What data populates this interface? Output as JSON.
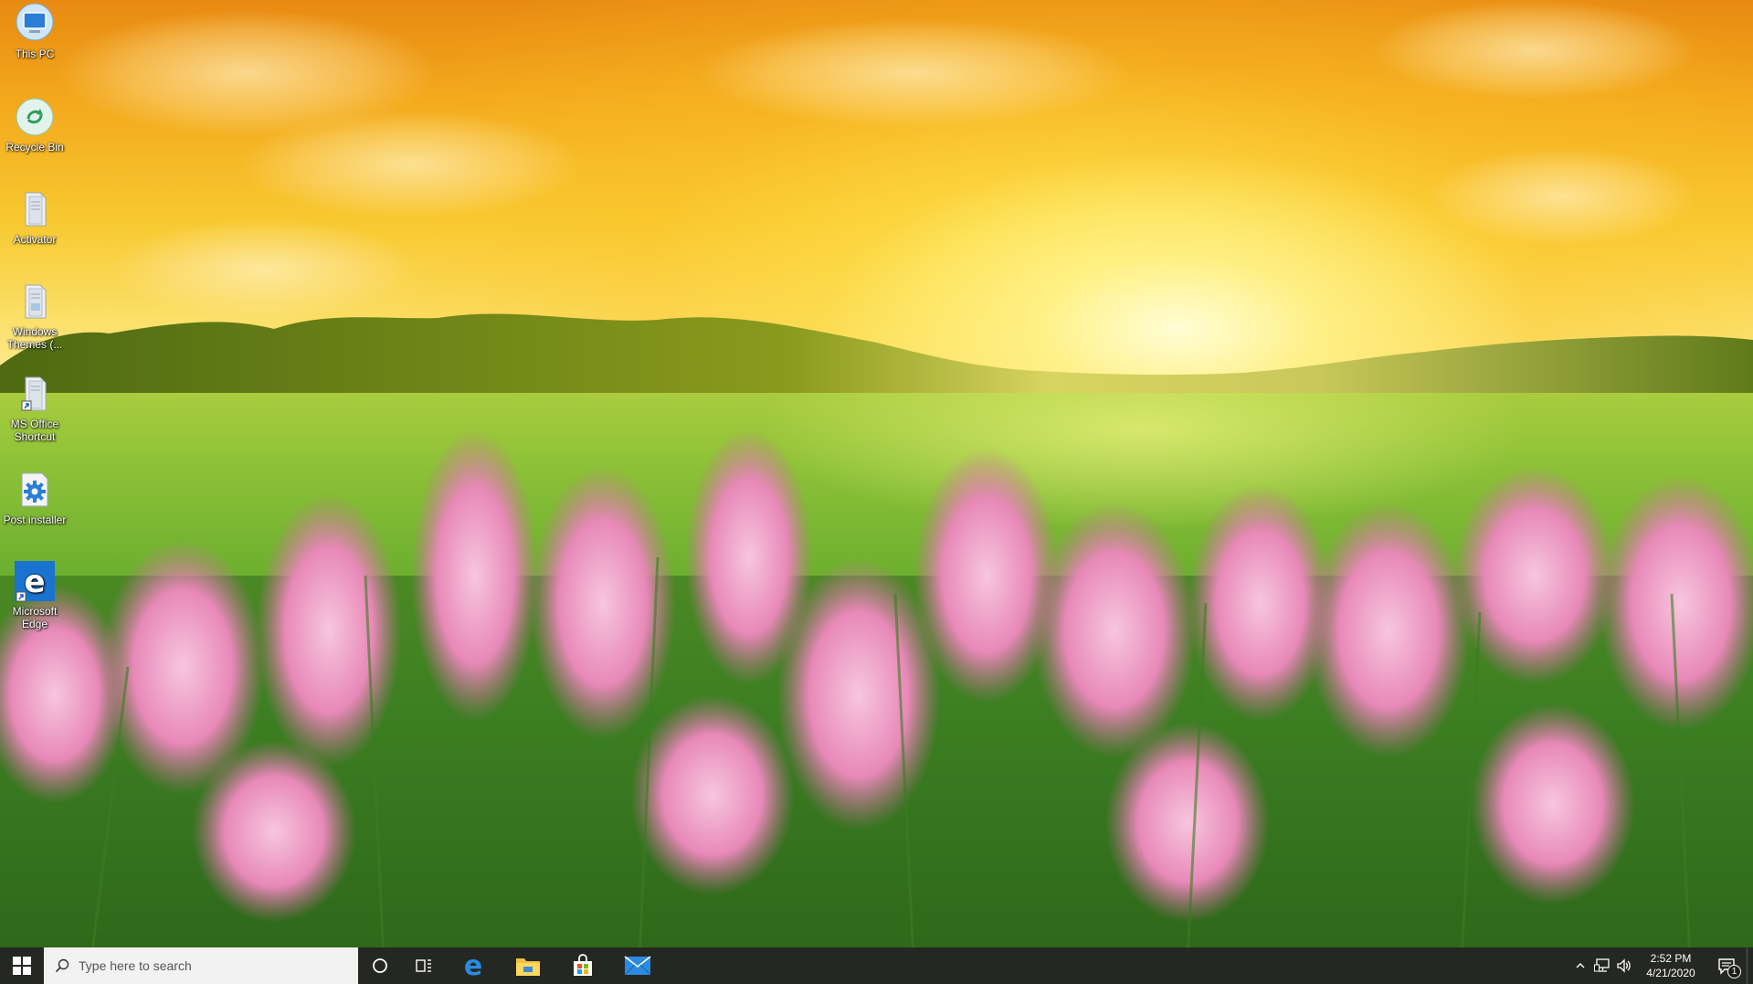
{
  "desktop": {
    "icons": [
      {
        "label": "This PC",
        "icon": "computer-icon"
      },
      {
        "label": "Recycle Bin",
        "icon": "recycle-bin-icon"
      },
      {
        "label": "Activator",
        "icon": "document-icon"
      },
      {
        "label": "Windows Themes (...",
        "icon": "document-icon"
      },
      {
        "label": "MS Office Shortcut",
        "icon": "shortcut-document-icon"
      },
      {
        "label": "Post installer",
        "icon": "gear-icon"
      },
      {
        "label": "Microsoft Edge",
        "icon": "edge-icon"
      }
    ]
  },
  "taskbar": {
    "search_placeholder": "Type here to search",
    "pinned": [
      {
        "name": "Microsoft Edge",
        "icon": "edge-icon"
      },
      {
        "name": "File Explorer",
        "icon": "folder-icon"
      },
      {
        "name": "Microsoft Store",
        "icon": "store-icon"
      },
      {
        "name": "Mail",
        "icon": "mail-icon"
      }
    ],
    "clock": {
      "time": "2:52 PM",
      "date": "4/21/2020"
    },
    "notification_count": "1"
  },
  "colors": {
    "taskbar_bg": "#1c1e1a",
    "search_bg": "#f2f2f2",
    "accent": "#0078d7",
    "edge_blue": "#1a73d0"
  }
}
